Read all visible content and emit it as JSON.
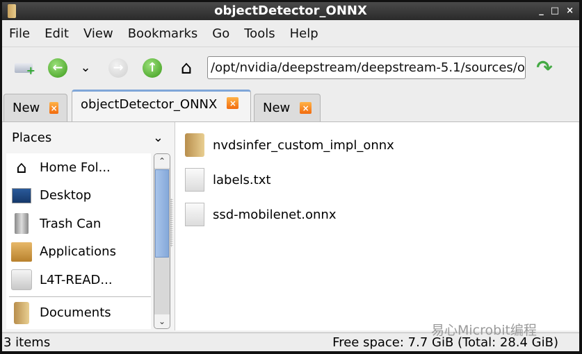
{
  "window": {
    "title": "objectDetector_ONNX",
    "controls": [
      "_",
      "□",
      "×"
    ]
  },
  "menu": [
    "File",
    "Edit",
    "View",
    "Bookmarks",
    "Go",
    "Tools",
    "Help"
  ],
  "toolbar": {
    "path": "/opt/nvidia/deepstream/deepstream-5.1/sources/o",
    "history_arrow": "⌄"
  },
  "tabs": [
    {
      "label": "New",
      "active": false
    },
    {
      "label": "objectDetector_ONNX",
      "active": true
    },
    {
      "label": "New",
      "active": false
    }
  ],
  "sidebar": {
    "title": "Places",
    "items": [
      {
        "label": "Home Fol...",
        "icon": "home-icon"
      },
      {
        "label": "Desktop",
        "icon": "desktop-icon"
      },
      {
        "label": "Trash Can",
        "icon": "trash-icon"
      },
      {
        "label": "Applications",
        "icon": "applications-icon"
      },
      {
        "label": "L4T-READ...",
        "icon": "drive-icon"
      },
      {
        "label": "Documents",
        "icon": "folder-icon"
      }
    ]
  },
  "files": [
    {
      "name": "nvdsinfer_custom_impl_onnx",
      "type": "folder"
    },
    {
      "name": "labels.txt",
      "type": "file"
    },
    {
      "name": "ssd-mobilenet.onnx",
      "type": "file"
    }
  ],
  "status": {
    "items": "3 items",
    "free_space": "Free space: 7.7 GiB (Total: 28.4 GiB)"
  },
  "watermark": "易心Microbit编程"
}
